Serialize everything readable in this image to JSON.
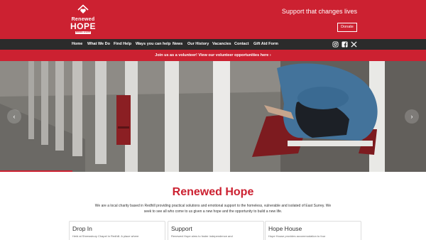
{
  "header": {
    "logo": {
      "line1": "Renewed",
      "line2": "HOPE",
      "subtitle": "REDHILL & EAST SURREY"
    },
    "tagline": "Support that changes lives",
    "donate_label": "Donate"
  },
  "nav": {
    "items": [
      "Home",
      "What We Do",
      "Find Help",
      "Ways you can help",
      "News",
      "Our History",
      "Vacancies",
      "Contact",
      "Gift Aid Form"
    ],
    "social_icons": [
      "instagram-icon",
      "facebook-icon",
      "x-icon"
    ]
  },
  "announcement": {
    "text": "Join us as a volunteer! View our volunteer opportunities here",
    "chevron": "›"
  },
  "hero": {
    "prev_label": "‹",
    "next_label": "›",
    "image": "person-sleeping-on-bench-under-colonnade"
  },
  "main": {
    "title": "Renewed Hope",
    "intro": "We are a local charity based in Redhill providing practical solutions and emotional support to the homeless, vulnerable and isolated of East Surrey. We seek to see all who come to us given a new hope and the opportunity to build a new life."
  },
  "cards": [
    {
      "title": "Drop In",
      "text": "Held at Shrewsbury Chapel in Redhill. A place where"
    },
    {
      "title": "Support",
      "text": "Renewed Hope aims to foster independence and"
    },
    {
      "title": "Hope House",
      "text": "Hope House provides accommodation to four"
    }
  ],
  "colors": {
    "brand_red": "#cc2131",
    "nav_dark": "#2b2b2b"
  }
}
